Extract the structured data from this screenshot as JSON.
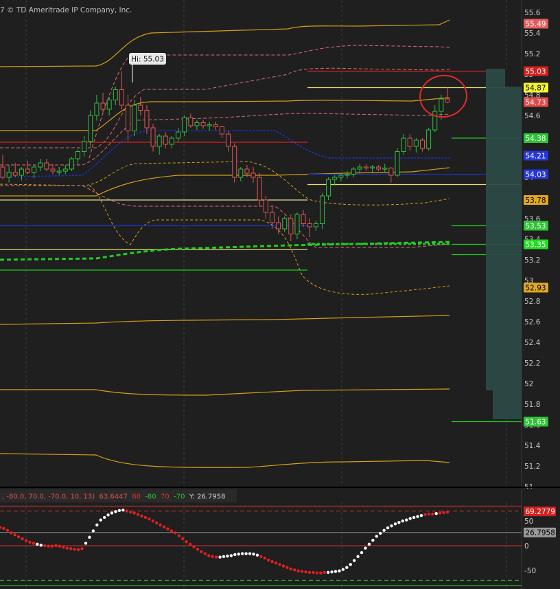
{
  "window": {
    "copyright": "7 © TD Ameritrade IP Company, Inc."
  },
  "colors": {
    "background": "#1f1f1f",
    "grid": "#3b3b3b",
    "up": "#2fbf3f",
    "down": "#e05555",
    "orange": "#d4a017",
    "pink_dash": "#e06a7a",
    "blue": "#1a33c8",
    "green_level": "#22cc22",
    "red_level": "#dd2222",
    "yellow_level": "#e8e070",
    "teal_bar": "#2c4a47"
  },
  "chart_data": [
    {
      "type": "candlestick",
      "title": "",
      "ylim": [
        51.0,
        55.7
      ],
      "y_ticks": [
        "55.6",
        "55.4",
        "55.2",
        "55",
        "54.8",
        "54.6",
        "54.4",
        "54.2",
        "54",
        "53.8",
        "53.6",
        "53.4",
        "53.2",
        "53",
        "52.8",
        "52.6",
        "52.4",
        "52.2",
        "52",
        "51.8",
        "51.6",
        "51.4",
        "51.2",
        "51"
      ],
      "hi_annotation": "Hi: 55.03",
      "candles": [
        {
          "o": 54.1,
          "h": 54.22,
          "l": 53.98,
          "c": 54.0
        },
        {
          "o": 54.0,
          "h": 54.12,
          "l": 53.95,
          "c": 54.05
        },
        {
          "o": 54.05,
          "h": 54.14,
          "l": 54.0,
          "c": 54.02
        },
        {
          "o": 54.02,
          "h": 54.1,
          "l": 53.97,
          "c": 54.08
        },
        {
          "o": 54.08,
          "h": 54.16,
          "l": 54.03,
          "c": 54.05
        },
        {
          "o": 54.05,
          "h": 54.12,
          "l": 53.99,
          "c": 54.1
        },
        {
          "o": 54.1,
          "h": 54.18,
          "l": 54.06,
          "c": 54.14
        },
        {
          "o": 54.14,
          "h": 54.18,
          "l": 54.06,
          "c": 54.08
        },
        {
          "o": 54.08,
          "h": 54.13,
          "l": 54.03,
          "c": 54.06
        },
        {
          "o": 54.06,
          "h": 54.1,
          "l": 54.02,
          "c": 54.06
        },
        {
          "o": 54.06,
          "h": 54.12,
          "l": 54.03,
          "c": 54.08
        },
        {
          "o": 54.08,
          "h": 54.2,
          "l": 54.06,
          "c": 54.18
        },
        {
          "o": 54.18,
          "h": 54.27,
          "l": 54.12,
          "c": 54.25
        },
        {
          "o": 54.25,
          "h": 54.4,
          "l": 54.2,
          "c": 54.35
        },
        {
          "o": 54.35,
          "h": 54.65,
          "l": 54.3,
          "c": 54.6
        },
        {
          "o": 54.6,
          "h": 54.8,
          "l": 54.55,
          "c": 54.72
        },
        {
          "o": 54.72,
          "h": 54.82,
          "l": 54.62,
          "c": 54.66
        },
        {
          "o": 54.66,
          "h": 54.78,
          "l": 54.6,
          "c": 54.75
        },
        {
          "o": 54.75,
          "h": 54.88,
          "l": 54.7,
          "c": 54.85
        },
        {
          "o": 54.85,
          "h": 55.03,
          "l": 54.66,
          "c": 54.7
        },
        {
          "o": 54.7,
          "h": 54.8,
          "l": 54.35,
          "c": 54.45
        },
        {
          "o": 54.45,
          "h": 54.75,
          "l": 54.4,
          "c": 54.7
        },
        {
          "o": 54.7,
          "h": 54.78,
          "l": 54.6,
          "c": 54.65
        },
        {
          "o": 54.65,
          "h": 54.7,
          "l": 54.42,
          "c": 54.48
        },
        {
          "o": 54.48,
          "h": 54.52,
          "l": 54.25,
          "c": 54.3
        },
        {
          "o": 54.3,
          "h": 54.42,
          "l": 54.22,
          "c": 54.4
        },
        {
          "o": 54.4,
          "h": 54.44,
          "l": 54.28,
          "c": 54.32
        },
        {
          "o": 54.32,
          "h": 54.4,
          "l": 54.28,
          "c": 54.38
        },
        {
          "o": 54.38,
          "h": 54.48,
          "l": 54.34,
          "c": 54.44
        },
        {
          "o": 54.44,
          "h": 54.6,
          "l": 54.4,
          "c": 54.58
        },
        {
          "o": 54.58,
          "h": 54.62,
          "l": 54.48,
          "c": 54.5
        },
        {
          "o": 54.5,
          "h": 54.56,
          "l": 54.46,
          "c": 54.53
        },
        {
          "o": 54.53,
          "h": 54.56,
          "l": 54.47,
          "c": 54.5
        },
        {
          "o": 54.5,
          "h": 54.54,
          "l": 54.45,
          "c": 54.51
        },
        {
          "o": 54.51,
          "h": 54.54,
          "l": 54.46,
          "c": 54.49
        },
        {
          "o": 54.49,
          "h": 54.5,
          "l": 54.38,
          "c": 54.42
        },
        {
          "o": 54.42,
          "h": 54.45,
          "l": 54.25,
          "c": 54.3
        },
        {
          "o": 54.3,
          "h": 54.33,
          "l": 53.95,
          "c": 54.0
        },
        {
          "o": 54.0,
          "h": 54.1,
          "l": 53.96,
          "c": 54.08
        },
        {
          "o": 54.08,
          "h": 54.12,
          "l": 54.0,
          "c": 54.04
        },
        {
          "o": 54.04,
          "h": 54.1,
          "l": 53.95,
          "c": 54.0
        },
        {
          "o": 54.0,
          "h": 54.04,
          "l": 53.72,
          "c": 53.78
        },
        {
          "o": 53.78,
          "h": 53.82,
          "l": 53.6,
          "c": 53.66
        },
        {
          "o": 53.66,
          "h": 53.72,
          "l": 53.5,
          "c": 53.56
        },
        {
          "o": 53.56,
          "h": 53.62,
          "l": 53.45,
          "c": 53.5
        },
        {
          "o": 53.5,
          "h": 53.62,
          "l": 53.47,
          "c": 53.6
        },
        {
          "o": 53.6,
          "h": 53.64,
          "l": 53.38,
          "c": 53.45
        },
        {
          "o": 53.45,
          "h": 53.66,
          "l": 53.4,
          "c": 53.64
        },
        {
          "o": 53.64,
          "h": 53.68,
          "l": 53.52,
          "c": 53.55
        },
        {
          "o": 53.55,
          "h": 53.6,
          "l": 53.42,
          "c": 53.52
        },
        {
          "o": 53.52,
          "h": 53.58,
          "l": 53.48,
          "c": 53.55
        },
        {
          "o": 53.55,
          "h": 53.85,
          "l": 53.5,
          "c": 53.82
        },
        {
          "o": 53.82,
          "h": 54.0,
          "l": 53.78,
          "c": 53.98
        },
        {
          "o": 53.98,
          "h": 54.02,
          "l": 53.92,
          "c": 54.0
        },
        {
          "o": 54.0,
          "h": 54.04,
          "l": 53.96,
          "c": 54.02
        },
        {
          "o": 54.02,
          "h": 54.06,
          "l": 53.99,
          "c": 54.03
        },
        {
          "o": 54.03,
          "h": 54.1,
          "l": 54.0,
          "c": 54.08
        },
        {
          "o": 54.08,
          "h": 54.13,
          "l": 54.04,
          "c": 54.1
        },
        {
          "o": 54.1,
          "h": 54.13,
          "l": 54.06,
          "c": 54.09
        },
        {
          "o": 54.09,
          "h": 54.12,
          "l": 54.05,
          "c": 54.1
        },
        {
          "o": 54.1,
          "h": 54.12,
          "l": 54.06,
          "c": 54.08
        },
        {
          "o": 54.08,
          "h": 54.13,
          "l": 54.05,
          "c": 54.09
        },
        {
          "o": 54.09,
          "h": 54.1,
          "l": 53.95,
          "c": 54.02
        },
        {
          "o": 54.02,
          "h": 54.28,
          "l": 54.0,
          "c": 54.25
        },
        {
          "o": 54.25,
          "h": 54.42,
          "l": 54.22,
          "c": 54.38
        },
        {
          "o": 54.38,
          "h": 54.42,
          "l": 54.26,
          "c": 54.3
        },
        {
          "o": 54.3,
          "h": 54.38,
          "l": 54.24,
          "c": 54.36
        },
        {
          "o": 54.36,
          "h": 54.38,
          "l": 54.25,
          "c": 54.28
        },
        {
          "o": 54.28,
          "h": 54.48,
          "l": 54.26,
          "c": 54.46
        },
        {
          "o": 54.46,
          "h": 54.7,
          "l": 54.44,
          "c": 54.64
        },
        {
          "o": 54.64,
          "h": 54.8,
          "l": 54.56,
          "c": 54.76
        },
        {
          "o": 54.76,
          "h": 54.87,
          "l": 54.72,
          "c": 54.73
        }
      ],
      "price_labels": [
        {
          "value": "55.49",
          "color": "#e25e5e",
          "text_color": "#ffffff"
        },
        {
          "value": "55.03",
          "color": "#d42020",
          "text_color": "#ffffff"
        },
        {
          "value": "54.87",
          "color": "#f5f52a",
          "text_color": "#000000"
        },
        {
          "value": "54.73",
          "color": "#e24a4a",
          "text_color": "#ffffff"
        },
        {
          "value": "54.38",
          "color": "#2ec436",
          "text_color": "#ffffff"
        },
        {
          "value": "54.21",
          "color": "#2636d8",
          "text_color": "#ffffff"
        },
        {
          "value": "54.03",
          "color": "#2636d8",
          "text_color": "#ffffff"
        },
        {
          "value": "53.78",
          "color": "#e0a820",
          "text_color": "#000000"
        },
        {
          "value": "53.53",
          "color": "#2ec436",
          "text_color": "#ffffff"
        },
        {
          "value": "53.35",
          "color": "#22dd22",
          "text_color": "#ffffff"
        },
        {
          "value": "52.93",
          "color": "#e0a820",
          "text_color": "#000000"
        },
        {
          "value": "51.63",
          "color": "#2ec436",
          "text_color": "#ffffff"
        }
      ]
    },
    {
      "type": "scatter",
      "title": "",
      "indicator_header": {
        "params": ", -80.0, 70.0, -70.0, 10, 13)",
        "value": "63.6447",
        "ob": "80",
        "os": "-80",
        "ob2": "70",
        "os2": "-70",
        "y_readout": "Y: 26.7958"
      },
      "ylim": [
        -62,
        70
      ],
      "y_ticks": [
        "50",
        "0",
        "-50"
      ],
      "levels": [
        80,
        70,
        0,
        -70,
        -80
      ],
      "price_labels": [
        {
          "value": "69.2779",
          "color": "#d42020",
          "text_color": "#ffffff"
        },
        {
          "value": "26.7958",
          "color": "#9a9a9a",
          "text_color": "#000000"
        }
      ],
      "dot_values": [
        37,
        35,
        31,
        26,
        22,
        18,
        14,
        10,
        7,
        5,
        3,
        1,
        0,
        -1,
        -1,
        0,
        -1,
        -3,
        -5,
        -6,
        -7,
        -8,
        -6,
        5,
        17,
        30,
        42,
        52,
        57,
        62,
        66,
        69,
        71,
        72,
        70,
        68,
        66,
        63,
        60,
        57,
        54,
        50,
        46,
        42,
        38,
        34,
        30,
        26,
        20,
        14,
        8,
        3,
        -2,
        -7,
        -12,
        -16,
        -20,
        -22,
        -23,
        -23,
        -22,
        -21,
        -20,
        -18,
        -17,
        -16,
        -16,
        -16,
        -17,
        -19,
        -22,
        -25,
        -29,
        -32,
        -35,
        -38,
        -41,
        -44,
        -47,
        -49,
        -51,
        -52,
        -53,
        -54,
        -54,
        -55,
        -55,
        -54,
        -54,
        -53,
        -52,
        -51,
        -48,
        -44,
        -38,
        -30,
        -22,
        -14,
        -5,
        3,
        11,
        19,
        25,
        31,
        36,
        40,
        44,
        47,
        50,
        52,
        55,
        57,
        59,
        61,
        63,
        64,
        64,
        65,
        66,
        67,
        68
      ],
      "dot_colors": [
        "r",
        "r",
        "r",
        "r",
        "r",
        "r",
        "r",
        "r",
        "r",
        "r",
        "w",
        "w",
        "r",
        "r",
        "r",
        "r",
        "r",
        "r",
        "r",
        "r",
        "r",
        "r",
        "r",
        "w",
        "w",
        "w",
        "w",
        "w",
        "w",
        "w",
        "w",
        "w",
        "w",
        "w",
        "r",
        "r",
        "r",
        "r",
        "r",
        "r",
        "r",
        "r",
        "r",
        "r",
        "r",
        "r",
        "r",
        "r",
        "r",
        "r",
        "r",
        "r",
        "r",
        "r",
        "r",
        "r",
        "r",
        "r",
        "r",
        "w",
        "w",
        "w",
        "w",
        "w",
        "w",
        "w",
        "w",
        "w",
        "w",
        "w",
        "r",
        "r",
        "r",
        "r",
        "r",
        "r",
        "r",
        "r",
        "r",
        "r",
        "r",
        "r",
        "r",
        "r",
        "r",
        "r",
        "r",
        "r",
        "w",
        "w",
        "w",
        "w",
        "w",
        "w",
        "w",
        "w",
        "w",
        "w",
        "w",
        "w",
        "w",
        "w",
        "w",
        "w",
        "w",
        "w",
        "w",
        "w",
        "w",
        "w",
        "w",
        "w",
        "w",
        "w",
        "r",
        "r",
        "r",
        "w",
        "r",
        "r"
      ]
    }
  ]
}
